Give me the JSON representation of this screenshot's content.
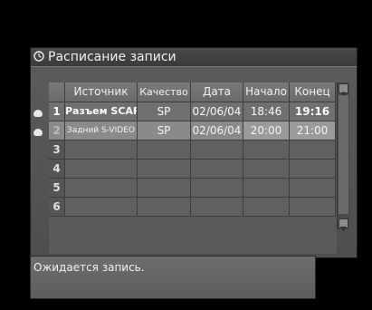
{
  "window": {
    "title": "Расписание записи",
    "title_icon": "clock-icon"
  },
  "table": {
    "headers": [
      "",
      "Источник",
      "Качество",
      "Дата",
      "Начало",
      "Конец"
    ],
    "rows": [
      {
        "num": "1",
        "source": "Разъем SCAR",
        "quality": "SP",
        "date": "02/06/04",
        "start": "18:46",
        "end": "19:16",
        "marker": "timer-icon"
      },
      {
        "num": "2",
        "source": "Задний S-VIDEO",
        "quality": "SP",
        "date": "02/06/04",
        "start": "20:00",
        "end": "21:00",
        "marker": "timer-icon"
      },
      {
        "num": "3",
        "source": "",
        "quality": "",
        "date": "",
        "start": "",
        "end": ""
      },
      {
        "num": "4",
        "source": "",
        "quality": "",
        "date": "",
        "start": "",
        "end": ""
      },
      {
        "num": "5",
        "source": "",
        "quality": "",
        "date": "",
        "start": "",
        "end": ""
      },
      {
        "num": "6",
        "source": "",
        "quality": "",
        "date": "",
        "start": "",
        "end": ""
      }
    ]
  },
  "scrollbar": {
    "up_icon": "scroll-up-icon",
    "down_icon": "scroll-down-icon"
  },
  "status": {
    "message": "Ожидается запись."
  }
}
